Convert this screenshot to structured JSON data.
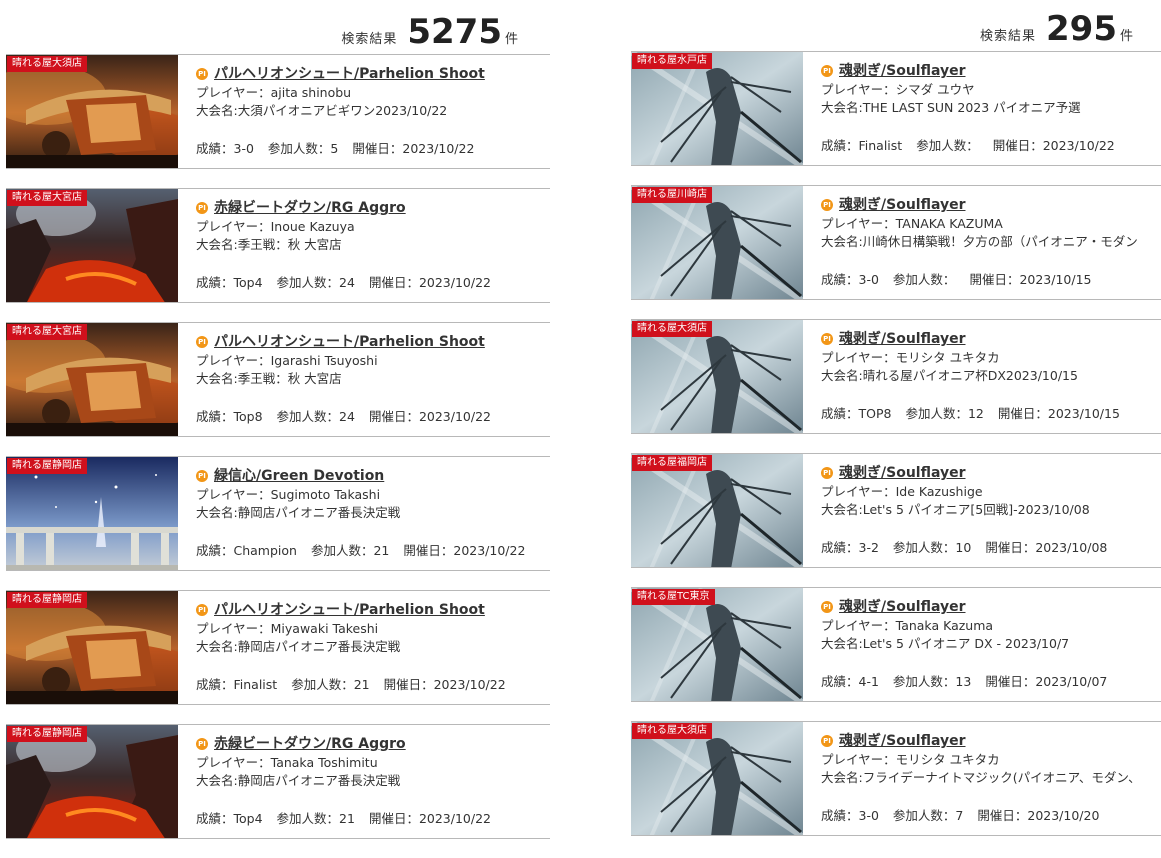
{
  "left": {
    "count_label": "検索結果",
    "count": "5275",
    "count_unit": "件",
    "cards": [
      {
        "shop": "晴れる屋大須店",
        "art": "parhelion",
        "deck": "パルヘリオンシュート/Parhelion Shoot",
        "player": "プレイヤー：ajita shinobu",
        "event": "大会名:大須パイオニアビギワン2023/10/22",
        "result": "成績：3-0",
        "participants": "参加人数：5",
        "date": "開催日：2023/10/22"
      },
      {
        "shop": "晴れる屋大宮店",
        "art": "rg",
        "deck": "赤緑ビートダウン/RG Aggro",
        "player": "プレイヤー：Inoue Kazuya",
        "event": "大会名:季王戦：秋 大宮店",
        "result": "成績：Top4",
        "participants": "参加人数：24",
        "date": "開催日：2023/10/22"
      },
      {
        "shop": "晴れる屋大宮店",
        "art": "parhelion",
        "deck": "パルヘリオンシュート/Parhelion Shoot",
        "player": "プレイヤー：Igarashi Tsuyoshi",
        "event": "大会名:季王戦：秋 大宮店",
        "result": "成績：Top8",
        "participants": "参加人数：24",
        "date": "開催日：2023/10/22"
      },
      {
        "shop": "晴れる屋静岡店",
        "art": "green",
        "deck": "緑信心/Green Devotion",
        "player": "プレイヤー：Sugimoto Takashi",
        "event": "大会名:静岡店パイオニア番長決定戦",
        "result": "成績：Champion",
        "participants": "参加人数：21",
        "date": "開催日：2023/10/22"
      },
      {
        "shop": "晴れる屋静岡店",
        "art": "parhelion",
        "deck": "パルヘリオンシュート/Parhelion Shoot",
        "player": "プレイヤー：Miyawaki Takeshi",
        "event": "大会名:静岡店パイオニア番長決定戦",
        "result": "成績：Finalist",
        "participants": "参加人数：21",
        "date": "開催日：2023/10/22"
      },
      {
        "shop": "晴れる屋静岡店",
        "art": "rg",
        "deck": "赤緑ビートダウン/RG Aggro",
        "player": "プレイヤー：Tanaka Toshimitu",
        "event": "大会名:静岡店パイオニア番長決定戦",
        "result": "成績：Top4",
        "participants": "参加人数：21",
        "date": "開催日：2023/10/22"
      }
    ]
  },
  "right": {
    "count_label": "検索結果",
    "count": "295",
    "count_unit": "件",
    "cards": [
      {
        "shop": "晴れる屋水戸店",
        "art": "soul",
        "deck": "魂剥ぎ/Soulflayer",
        "player": "プレイヤー：シマダ ユウヤ",
        "event": "大会名:THE LAST SUN 2023 パイオニア予選",
        "result": "成績：Finalist",
        "participants": "参加人数：",
        "date": "開催日：2023/10/22"
      },
      {
        "shop": "晴れる屋川崎店",
        "art": "soul",
        "deck": "魂剥ぎ/Soulflayer",
        "player": "プレイヤー：TANAKA KAZUMA",
        "event": "大会名:川崎休日構築戦！夕方の部（パイオニア・モダン",
        "result": "成績：3-0",
        "participants": "参加人数：",
        "date": "開催日：2023/10/15"
      },
      {
        "shop": "晴れる屋大須店",
        "art": "soul",
        "deck": "魂剥ぎ/Soulflayer",
        "player": "プレイヤー：モリシタ ユキタカ",
        "event": "大会名:晴れる屋パイオニア杯DX2023/10/15",
        "result": "成績：TOP8",
        "participants": "参加人数：12",
        "date": "開催日：2023/10/15"
      },
      {
        "shop": "晴れる屋福岡店",
        "art": "soul",
        "deck": "魂剥ぎ/Soulflayer",
        "player": "プレイヤー：Ide Kazushige",
        "event": "大会名:Let's 5 パイオニア[5回戦]-2023/10/08",
        "result": "成績：3-2",
        "participants": "参加人数：10",
        "date": "開催日：2023/10/08"
      },
      {
        "shop": "晴れる屋TC東京",
        "art": "soul",
        "deck": "魂剥ぎ/Soulflayer",
        "player": "プレイヤー：Tanaka Kazuma",
        "event": "大会名:Let's 5 パイオニア DX - 2023/10/7",
        "result": "成績：4-1",
        "participants": "参加人数：13",
        "date": "開催日：2023/10/07"
      },
      {
        "shop": "晴れる屋大須店",
        "art": "soul",
        "deck": "魂剥ぎ/Soulflayer",
        "player": "プレイヤー：モリシタ ユキタカ",
        "event": "大会名:フライデーナイトマジック(パイオニア、モダン、",
        "result": "成績：3-0",
        "participants": "参加人数：7",
        "date": "開催日：2023/10/20"
      }
    ]
  },
  "icon_label": "PI",
  "colors": {
    "shop_tag": "#d0101c",
    "pi_icon": "#f29617",
    "border": "#b8b8b8"
  }
}
